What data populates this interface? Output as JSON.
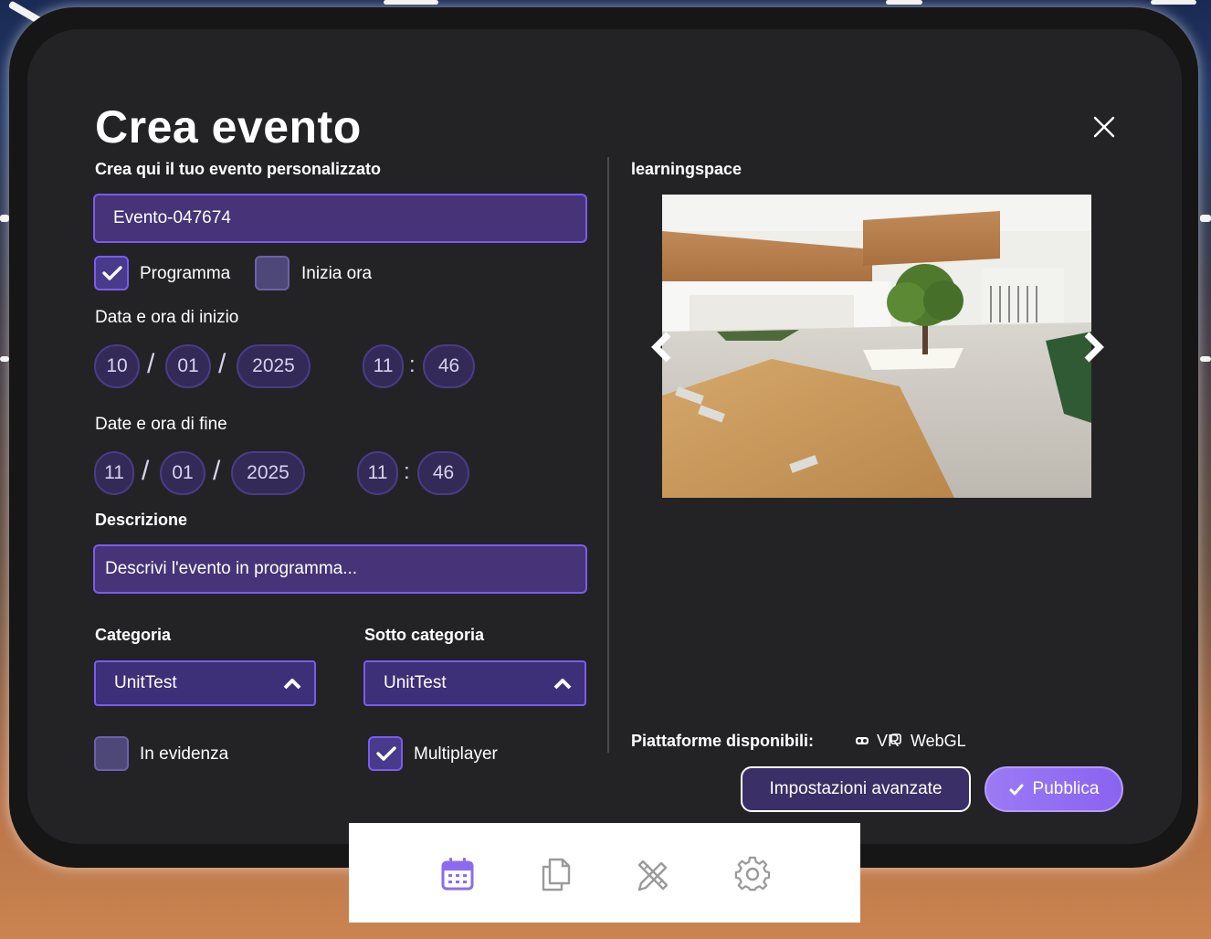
{
  "dialog": {
    "title": "Crea evento",
    "subtitle": "Crea qui il tuo evento personalizzato",
    "event_name": "Evento-047674"
  },
  "schedule": {
    "programma_label": "Programma",
    "programma_checked": true,
    "inizia_ora_label": "Inizia ora",
    "inizia_ora_checked": false
  },
  "start": {
    "label": "Data e ora di inizio",
    "day": "10",
    "month": "01",
    "year": "2025",
    "hour": "11",
    "minute": "46"
  },
  "end": {
    "label": "Date e ora di fine",
    "day": "11",
    "month": "01",
    "year": "2025",
    "hour": "11",
    "minute": "46"
  },
  "separators": {
    "date": "/",
    "time": ":"
  },
  "description": {
    "label": "Descrizione",
    "placeholder": "Descrivi l'evento in programma..."
  },
  "category": {
    "label": "Categoria",
    "value": "UnitTest"
  },
  "subcategory": {
    "label": "Sotto categoria",
    "value": "UnitTest"
  },
  "flags": {
    "evidenza_label": "In evidenza",
    "evidenza_checked": false,
    "multiplayer_label": "Multiplayer",
    "multiplayer_checked": true
  },
  "space": {
    "name": "learningspace"
  },
  "platforms": {
    "label": "Piattaforme disponibili:",
    "vr": "VR",
    "webgl": "WebGL"
  },
  "buttons": {
    "advanced": "Impostazioni avanzate",
    "publish": "Pubblica"
  },
  "toolbar": [
    "calendar-icon",
    "copy-icon",
    "edit-tools-icon",
    "settings-icon"
  ],
  "colors": {
    "accent": "#7a5cf0",
    "field": "#463378",
    "publish": "#9b7af5"
  }
}
